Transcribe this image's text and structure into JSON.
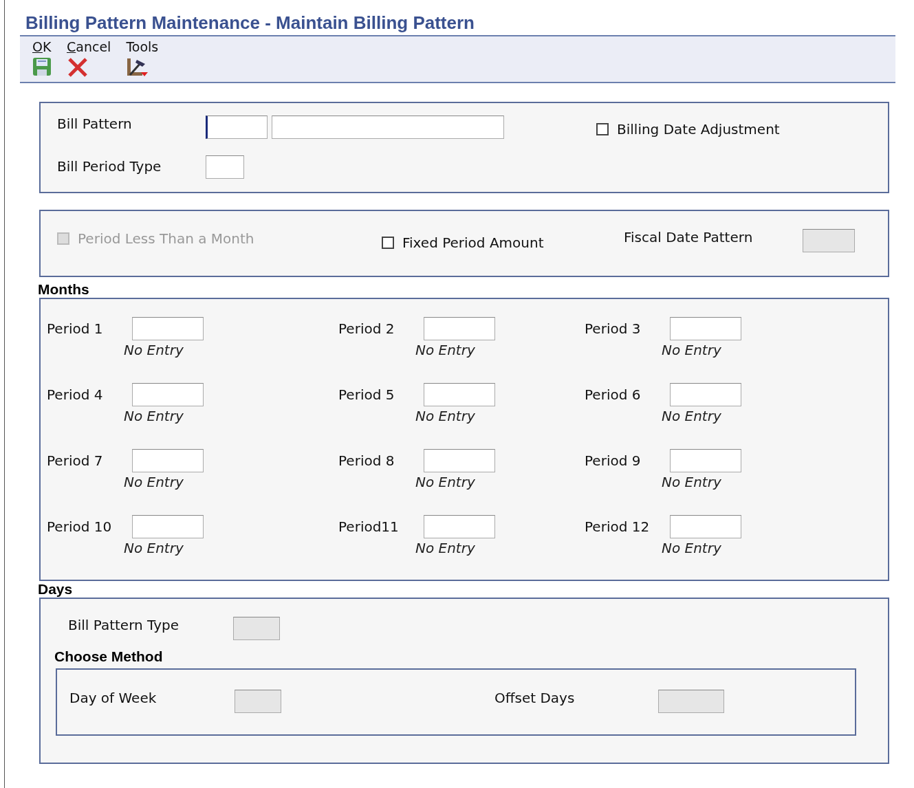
{
  "window": {
    "title": "Billing Pattern Maintenance - Maintain Billing Pattern"
  },
  "toolbar": [
    {
      "label": "OK",
      "kind": "save",
      "mnemonic": true
    },
    {
      "label": "Cancel",
      "kind": "cancel",
      "mnemonic": true
    },
    {
      "label": "Tools",
      "kind": "tools",
      "mnemonic": false
    }
  ],
  "header": {
    "bill_pattern": {
      "label": "Bill Pattern"
    },
    "bill_period_type": {
      "label": "Bill Period Type"
    },
    "billing_date_adjustment": {
      "label": "Billing Date Adjustment",
      "checked": false
    }
  },
  "options": {
    "period_less_than_month": {
      "label": "Period Less Than a Month",
      "checked": false,
      "disabled": true
    },
    "fixed_period_amount": {
      "label": "Fixed Period Amount",
      "checked": false,
      "disabled": false
    },
    "fiscal_date_pattern": {
      "label": "Fiscal Date Pattern",
      "disabled": true
    }
  },
  "months": {
    "title": "Months",
    "periods": [
      {
        "label": "Period 1",
        "hint": "No Entry"
      },
      {
        "label": "Period 2",
        "hint": "No Entry"
      },
      {
        "label": "Period 3",
        "hint": "No Entry"
      },
      {
        "label": "Period 4",
        "hint": "No Entry"
      },
      {
        "label": "Period 5",
        "hint": "No Entry"
      },
      {
        "label": "Period 6",
        "hint": "No Entry"
      },
      {
        "label": "Period 7",
        "hint": "No Entry"
      },
      {
        "label": "Period 8",
        "hint": "No Entry"
      },
      {
        "label": "Period 9",
        "hint": "No Entry"
      },
      {
        "label": "Period 10",
        "hint": "No Entry"
      },
      {
        "label": "Period11",
        "hint": "No Entry"
      },
      {
        "label": "Period 12",
        "hint": "No Entry"
      }
    ]
  },
  "days": {
    "title": "Days",
    "bill_pattern_type": {
      "label": "Bill Pattern Type",
      "disabled": true
    },
    "choose_method": {
      "title": "Choose Method",
      "day_of_week": {
        "label": "Day of Week",
        "disabled": true
      },
      "offset_days": {
        "label": "Offset Days",
        "disabled": true
      }
    }
  }
}
